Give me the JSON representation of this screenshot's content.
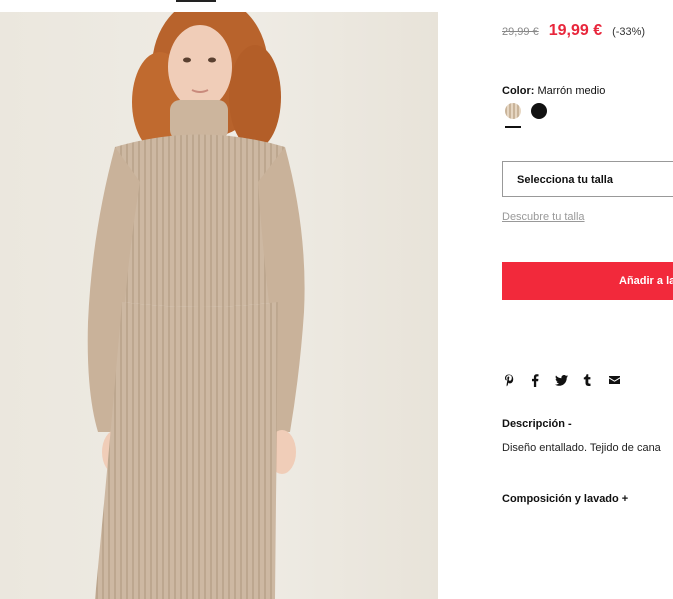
{
  "product": {
    "old_price": "29,99 €",
    "new_price": "19,99 €",
    "discount": "(-33%)",
    "color_label": "Color:",
    "color_value": "Marrón medio",
    "size_select_label": "Selecciona tu talla",
    "size_guide_link": "Descubre tu talla",
    "add_to_cart_label": "Añadir a la",
    "description_title": "Descripción  -",
    "description_text": "Diseño entallado. Tejido de cana",
    "composition_title": "Composición y lavado  +"
  },
  "swatches": [
    {
      "name": "beige",
      "color": "#d9c6ae",
      "selected": true
    },
    {
      "name": "black",
      "color": "#111111",
      "selected": false
    }
  ],
  "share_icons": [
    "pinterest-icon",
    "facebook-icon",
    "twitter-icon",
    "tumblr-icon",
    "email-icon"
  ],
  "colors": {
    "accent": "#f2293b",
    "price": "#e8263b"
  }
}
